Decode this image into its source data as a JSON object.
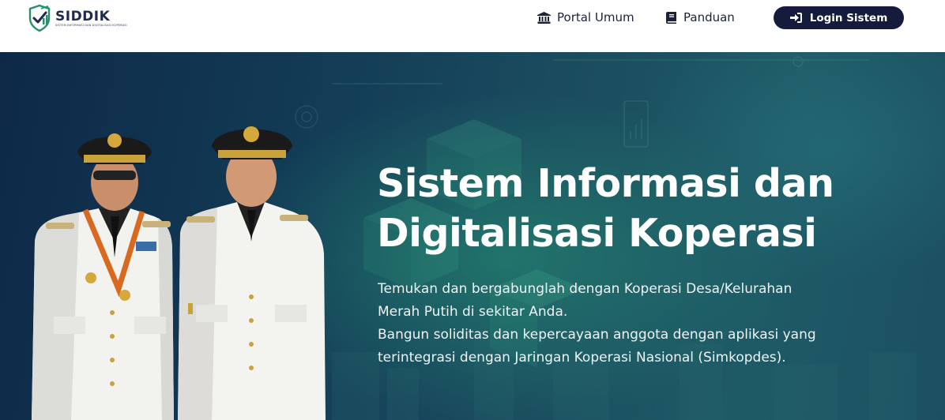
{
  "header": {
    "logo": {
      "name": "SIDDIK",
      "tagline": "SISTEM INFORMASI DAN DIGITALISASI KOPERASI"
    },
    "nav": [
      {
        "label": "Portal Umum",
        "icon": "bank-icon"
      },
      {
        "label": "Panduan",
        "icon": "book-icon"
      }
    ],
    "login": {
      "label": "Login Sistem",
      "icon": "sign-in-icon"
    }
  },
  "hero": {
    "title_line1": "Sistem Informasi dan",
    "title_line2": "Digitalisasi Koperasi",
    "subtitle_lines": [
      "Temukan dan bergabunglah dengan Koperasi Desa/Kelurahan",
      "Merah Putih di sekitar Anda.",
      "Bangun soliditas dan kepercayaan anggota dengan aplikasi yang",
      "terintegrasi dengan Jaringan Koperasi Nasional (Simkopdes)."
    ],
    "image": "two officials in white ceremonial uniforms"
  },
  "colors": {
    "header_bg": "#ffffff",
    "nav_text": "#1b2238",
    "login_bg": "#141b3d",
    "hero_dark": "#0e2948",
    "hero_teal": "#1e5a66"
  }
}
